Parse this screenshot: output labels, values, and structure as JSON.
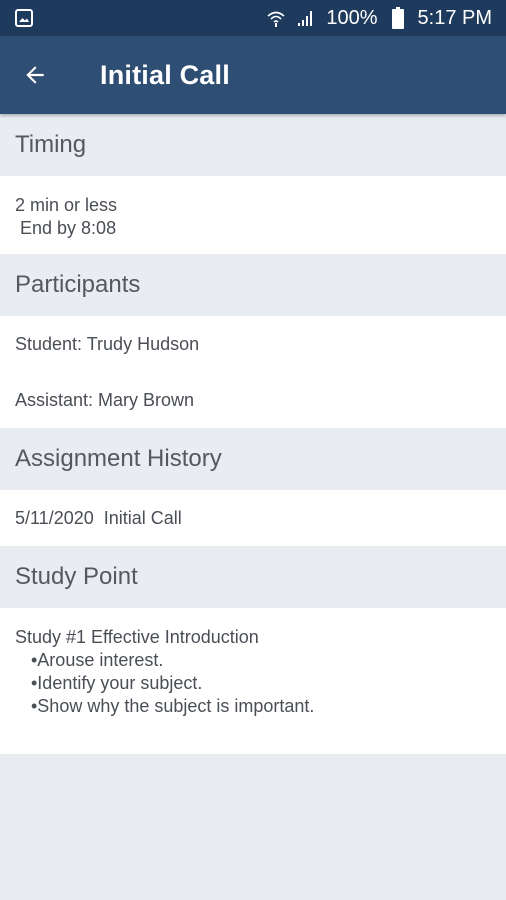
{
  "statusbar": {
    "battery_text": "100%",
    "time": "5:17 PM",
    "icons": [
      "image-icon",
      "wifi-icon",
      "signal-icon",
      "battery-icon"
    ]
  },
  "appbar": {
    "title": "Initial Call",
    "back_icon": "arrow-left-icon"
  },
  "timing": {
    "header": "Timing",
    "line1": "2 min or less",
    "line2": " End by 8:08"
  },
  "participants": {
    "header": "Participants",
    "student": "Student: Trudy Hudson",
    "assistant": "Assistant: Mary Brown"
  },
  "history": {
    "header": "Assignment History",
    "entry": "5/11/2020  Initial Call"
  },
  "study_point": {
    "header": "Study Point",
    "title": "Study #1 Effective Introduction",
    "bullets": [
      "•Arouse interest.",
      "•Identify your subject.",
      "•Show why the subject is important."
    ]
  },
  "colors": {
    "statusbar": "#1e3a5c",
    "appbar": "#2f4e73",
    "section_header_bg": "#e9ecf1"
  }
}
